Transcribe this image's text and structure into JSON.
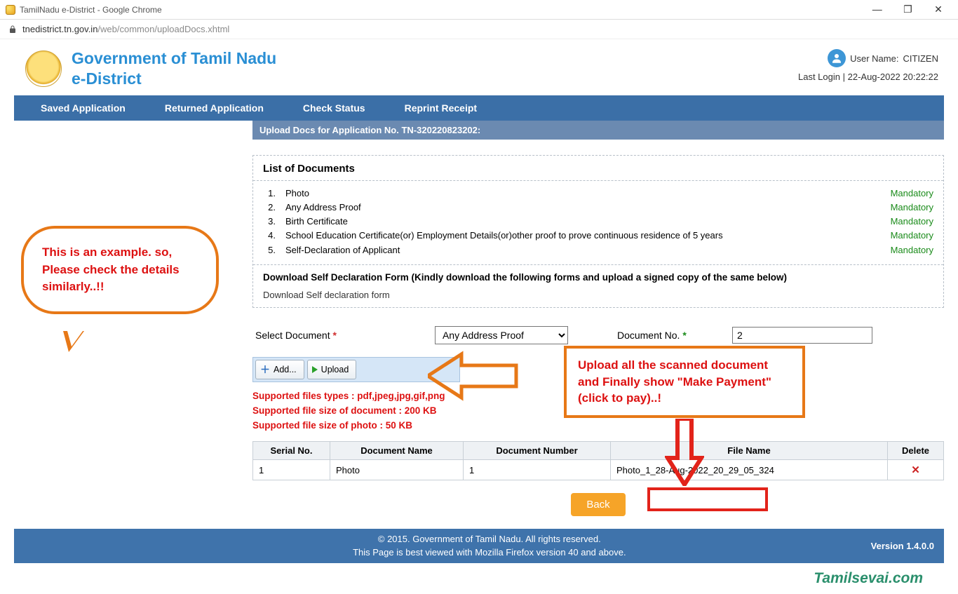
{
  "window": {
    "title": "TamilNadu e-District - Google Chrome",
    "url_host": "tnedistrict.tn.gov.in",
    "url_path": "/web/common/uploadDocs.xhtml"
  },
  "header": {
    "brand_line1": "Government of Tamil Nadu",
    "brand_line2": "e-District",
    "user_label": "User Name:",
    "user_name": "CITIZEN",
    "last_login_label": "Last Login |",
    "last_login_value": "22-Aug-2022 20:22:22"
  },
  "menu": {
    "saved": "Saved Application",
    "returned": "Returned Application",
    "check": "Check Status",
    "reprint": "Reprint Receipt"
  },
  "banner": "Upload Docs for Application No. TN-320220823202:",
  "docs": {
    "heading": "List of Documents",
    "items": [
      {
        "n": "1.",
        "name": "Photo",
        "m": "Mandatory"
      },
      {
        "n": "2.",
        "name": "Any Address Proof",
        "m": "Mandatory"
      },
      {
        "n": "3.",
        "name": "Birth Certificate",
        "m": "Mandatory"
      },
      {
        "n": "4.",
        "name": "School Education Certificate(or) Employment Details(or)other proof to prove continuous residence of 5 years",
        "m": "Mandatory"
      },
      {
        "n": "5.",
        "name": "Self-Declaration of Applicant",
        "m": "Mandatory"
      }
    ],
    "download_head": "Download Self Declaration Form (Kindly download the following forms and upload a signed copy of the same below)",
    "download_link": "Download Self declaration form"
  },
  "form": {
    "select_label": "Select Document",
    "select_value": "Any Address Proof",
    "docno_label": "Document No.",
    "docno_value": "2",
    "add_label": "Add...",
    "upload_label": "Upload",
    "support1": "Supported files types : pdf,jpeg,jpg,gif,png",
    "support2": "Supported file size of document : 200 KB",
    "support3": "Supported file size of photo : 50 KB"
  },
  "table": {
    "cols": {
      "serial": "Serial No.",
      "dname": "Document Name",
      "dnum": "Document Number",
      "fname": "File Name",
      "del": "Delete"
    },
    "rows": [
      {
        "serial": "1",
        "dname": "Photo",
        "dnum": "1",
        "fname": "Photo_1_28-Aug-2022_20_29_05_324"
      }
    ]
  },
  "actions": {
    "back": "Back"
  },
  "footer": {
    "line1": "© 2015. Government of Tamil Nadu. All rights reserved.",
    "line2": "This Page is best viewed with Mozilla Firefox version 40 and above.",
    "version": "Version 1.4.0.0"
  },
  "watermark": "Tamilsevai.com",
  "annotations": {
    "bubble": "This is an example. so, Please check the details similarly..!!",
    "callout": "Upload all the scanned document and Finally show \"Make Payment\" (click to pay)..!"
  }
}
